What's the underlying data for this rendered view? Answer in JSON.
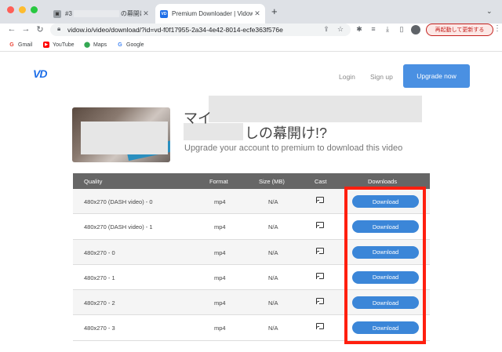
{
  "browser": {
    "tabs": [
      {
        "label": "#3",
        "suffix": "の幕開け!",
        "icon": "tab-icon"
      },
      {
        "label": "Premium Downloader | Vidow",
        "icon": "vd-icon"
      }
    ],
    "url": "vidow.io/video/download/?id=vd-f0f17955-2a34-4e42-8014-ecfe363f576e",
    "relaunch_label": "再起動して更新する",
    "bookmarks": [
      {
        "label": "Gmail",
        "icon": "gmail-icon"
      },
      {
        "label": "YouTube",
        "icon": "youtube-icon"
      },
      {
        "label": "Maps",
        "icon": "maps-icon"
      },
      {
        "label": "Google",
        "icon": "google-icon"
      }
    ]
  },
  "header": {
    "logo": "VD",
    "login": "Login",
    "signup": "Sign up",
    "upgrade": "Upgrade now"
  },
  "video": {
    "title_start": "マイ",
    "title_end": "しの幕開け!?",
    "subtitle": "Upgrade your account to premium to download this video"
  },
  "table": {
    "headers": {
      "quality": "Quality",
      "format": "Format",
      "size": "Size (MB)",
      "cast": "Cast",
      "downloads": "Downloads"
    },
    "rows": [
      {
        "quality": "480x270 (DASH video) - 0",
        "format": "mp4",
        "size": "N/A",
        "download": "Download"
      },
      {
        "quality": "480x270 (DASH video) - 1",
        "format": "mp4",
        "size": "N/A",
        "download": "Download"
      },
      {
        "quality": "480x270 - 0",
        "format": "mp4",
        "size": "N/A",
        "download": "Download"
      },
      {
        "quality": "480x270 - 1",
        "format": "mp4",
        "size": "N/A",
        "download": "Download"
      },
      {
        "quality": "480x270 - 2",
        "format": "mp4",
        "size": "N/A",
        "download": "Download"
      },
      {
        "quality": "480x270 - 3",
        "format": "mp4",
        "size": "N/A",
        "download": "Download"
      }
    ]
  },
  "colors": {
    "accent": "#4a90e2",
    "highlight": "#ff1f0f",
    "brand": "#1e6fe8"
  }
}
